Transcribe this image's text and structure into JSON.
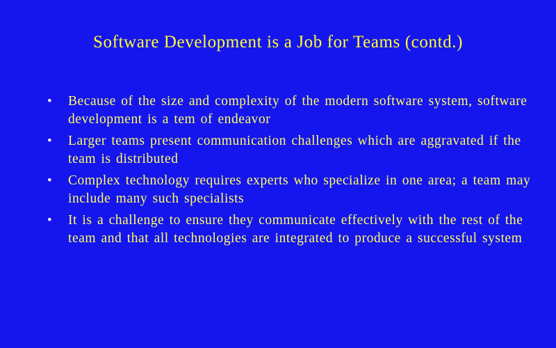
{
  "slide": {
    "title": "Software Development is a Job for Teams (contd.)",
    "bullet_glyph": "•",
    "bullets": [
      {
        "text": "Because of the size and complexity of the modern software system, software development is a tem of endeavor"
      },
      {
        "text": "Larger teams present communication challenges which are aggravated if the team is distributed"
      },
      {
        "text": "Complex technology requires experts who specialize in one area; a team may include many such specialists"
      },
      {
        "text": "It is a challenge to ensure they communicate effectively with the rest of the team and that all technologies are integrated to produce a successful system"
      }
    ]
  },
  "colors": {
    "background": "#1515ee",
    "title": "#ffff33",
    "body_text": "#ffff66",
    "bullet": "#ffffff"
  }
}
